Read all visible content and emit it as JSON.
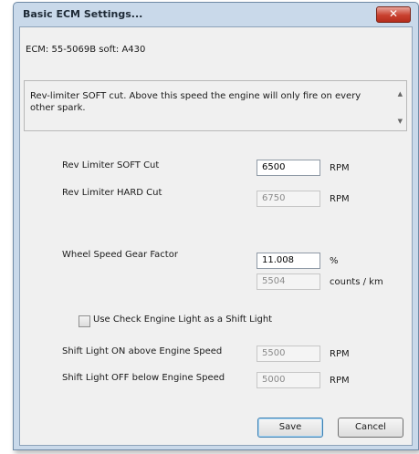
{
  "window": {
    "title": "Basic ECM Settings...",
    "close_glyph": "✕"
  },
  "ecm": {
    "info": "ECM: 55-5069B soft: A430"
  },
  "description": {
    "text": "Rev-limiter SOFT cut. Above this speed the engine will only fire on every other spark.",
    "scroll_up": "▲",
    "scroll_down": "▼"
  },
  "fields": {
    "rev_soft": {
      "label": "Rev Limiter SOFT Cut",
      "value": "6500",
      "unit": "RPM"
    },
    "rev_hard": {
      "label": "Rev Limiter HARD Cut",
      "value": "6750",
      "unit": "RPM"
    },
    "wheel_factor": {
      "label": "Wheel Speed Gear Factor",
      "value": "11.008",
      "unit": "%"
    },
    "counts": {
      "value": "5504",
      "unit": "counts / km"
    },
    "check_engine": {
      "label": "Use Check Engine Light as a Shift Light",
      "checked": false
    },
    "shift_on": {
      "label": "Shift Light ON above Engine Speed",
      "value": "5500",
      "unit": "RPM"
    },
    "shift_off": {
      "label": "Shift Light OFF below Engine Speed",
      "value": "5000",
      "unit": "RPM"
    }
  },
  "buttons": {
    "save": "Save",
    "cancel": "Cancel"
  }
}
